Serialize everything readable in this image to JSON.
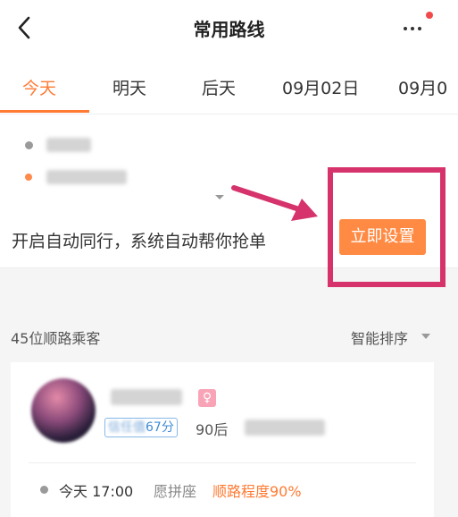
{
  "header": {
    "title": "常用路线"
  },
  "tabs": [
    {
      "label": "今天",
      "active": true
    },
    {
      "label": "明天",
      "active": false
    },
    {
      "label": "后天",
      "active": false
    },
    {
      "label": "09月02日",
      "active": false
    },
    {
      "label": "09月0",
      "active": false
    }
  ],
  "auto_share": {
    "text": "开启自动同行，系统自动帮你抢单",
    "button_label": "立即设置"
  },
  "passengers": {
    "count_label": "45位顺路乘客",
    "sort_label": "智能排序"
  },
  "passenger_card": {
    "gender_icon": "♀",
    "score_label": "67分",
    "age_label": "90后",
    "time": "今天 17:00",
    "seat": "愿拼座",
    "match": "顺路程度90%"
  },
  "colors": {
    "accent": "#ff7a33",
    "button": "#ff8a43",
    "annotation": "#d6336c"
  }
}
